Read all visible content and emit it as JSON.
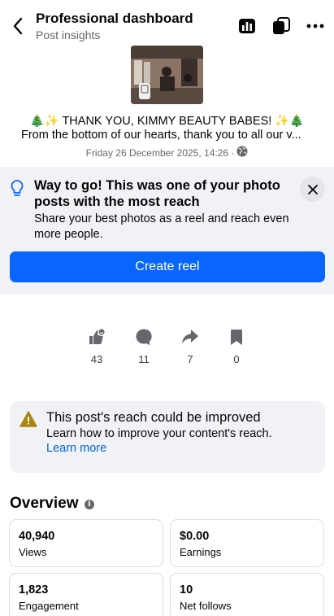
{
  "header": {
    "title": "Professional dashboard",
    "subtitle": "Post insights"
  },
  "post": {
    "title": "🎄✨ THANK YOU, KIMMY BEAUTY BABES! ✨🎄",
    "body": "From the bottom of our hearts, thank you to all our v...",
    "date": "Friday 26 December 2025, 14:26 ·"
  },
  "tip": {
    "title": "Way to go! This was one of your photo posts with the most reach",
    "description": "Share your best photos as a reel and reach even more people.",
    "button_label": "Create reel"
  },
  "engagement": [
    {
      "icon": "reactions-icon",
      "count": "43"
    },
    {
      "icon": "comment-icon",
      "count": "11"
    },
    {
      "icon": "share-icon",
      "count": "7"
    },
    {
      "icon": "save-icon",
      "count": "0"
    }
  ],
  "reach": {
    "title": "This post's reach could be improved",
    "description": "Learn how to improve your content's reach.",
    "link": "Learn more"
  },
  "overview": {
    "title": "Overview",
    "metrics": [
      {
        "value": "40,940",
        "label": "Views"
      },
      {
        "value": "$0.00",
        "label": "Earnings"
      },
      {
        "value": "1,823",
        "label": "Engagement"
      },
      {
        "value": "10",
        "label": "Net follows"
      }
    ]
  },
  "colors": {
    "accent": "#0866ff",
    "link": "#0064d1",
    "card_bg": "#f0f2f5",
    "warning": "#a9850e"
  }
}
